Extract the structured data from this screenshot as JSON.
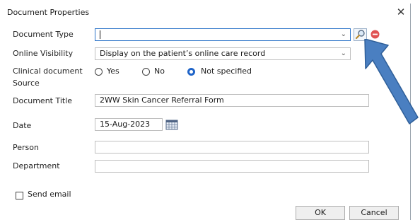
{
  "window": {
    "title": "Document Properties",
    "close_glyph": "✕"
  },
  "form": {
    "document_type": {
      "label": "Document Type",
      "value": ""
    },
    "online_visibility": {
      "label": "Online Visibility",
      "value": "Display on the patient’s online care record"
    },
    "clinical_source": {
      "label_line1": "Clinical document",
      "label_line2": "Source",
      "options": [
        "Yes",
        "No",
        "Not specified"
      ],
      "selected": "Not specified"
    },
    "document_title": {
      "label": "Document Title",
      "value": "2WW Skin Cancer Referral Form"
    },
    "date": {
      "label": "Date",
      "value": "15-Aug-2023"
    },
    "person": {
      "label": "Person",
      "value": ""
    },
    "department": {
      "label": "Department",
      "value": ""
    },
    "send_email": {
      "label": "Send email",
      "checked": false
    }
  },
  "buttons": {
    "ok": "OK",
    "cancel": "Cancel"
  },
  "icons": {
    "dropdown": "chevron-down-icon",
    "search": "magnifier-icon",
    "clear": "remove-icon",
    "calendar": "calendar-icon",
    "annotation": "arrow-annotation"
  },
  "colors": {
    "arrow_fill": "#4a7fc1",
    "arrow_stroke": "#2f5f99",
    "clear": "#e05252",
    "radio_checked": "#1f64c8",
    "focus_border": "#2b73c9"
  }
}
